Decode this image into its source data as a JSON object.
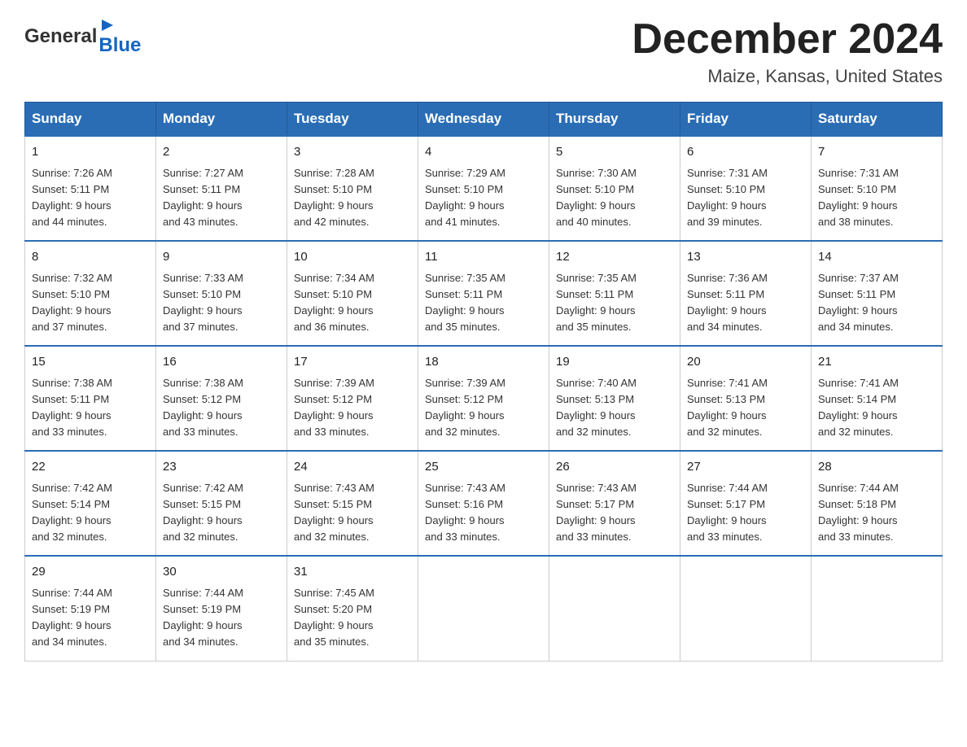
{
  "header": {
    "logo_general": "General",
    "logo_blue": "Blue",
    "month_title": "December 2024",
    "location": "Maize, Kansas, United States"
  },
  "days_of_week": [
    "Sunday",
    "Monday",
    "Tuesday",
    "Wednesday",
    "Thursday",
    "Friday",
    "Saturday"
  ],
  "weeks": [
    [
      {
        "day": "1",
        "sunrise": "7:26 AM",
        "sunset": "5:11 PM",
        "daylight": "9 hours and 44 minutes."
      },
      {
        "day": "2",
        "sunrise": "7:27 AM",
        "sunset": "5:11 PM",
        "daylight": "9 hours and 43 minutes."
      },
      {
        "day": "3",
        "sunrise": "7:28 AM",
        "sunset": "5:10 PM",
        "daylight": "9 hours and 42 minutes."
      },
      {
        "day": "4",
        "sunrise": "7:29 AM",
        "sunset": "5:10 PM",
        "daylight": "9 hours and 41 minutes."
      },
      {
        "day": "5",
        "sunrise": "7:30 AM",
        "sunset": "5:10 PM",
        "daylight": "9 hours and 40 minutes."
      },
      {
        "day": "6",
        "sunrise": "7:31 AM",
        "sunset": "5:10 PM",
        "daylight": "9 hours and 39 minutes."
      },
      {
        "day": "7",
        "sunrise": "7:31 AM",
        "sunset": "5:10 PM",
        "daylight": "9 hours and 38 minutes."
      }
    ],
    [
      {
        "day": "8",
        "sunrise": "7:32 AM",
        "sunset": "5:10 PM",
        "daylight": "9 hours and 37 minutes."
      },
      {
        "day": "9",
        "sunrise": "7:33 AM",
        "sunset": "5:10 PM",
        "daylight": "9 hours and 37 minutes."
      },
      {
        "day": "10",
        "sunrise": "7:34 AM",
        "sunset": "5:10 PM",
        "daylight": "9 hours and 36 minutes."
      },
      {
        "day": "11",
        "sunrise": "7:35 AM",
        "sunset": "5:11 PM",
        "daylight": "9 hours and 35 minutes."
      },
      {
        "day": "12",
        "sunrise": "7:35 AM",
        "sunset": "5:11 PM",
        "daylight": "9 hours and 35 minutes."
      },
      {
        "day": "13",
        "sunrise": "7:36 AM",
        "sunset": "5:11 PM",
        "daylight": "9 hours and 34 minutes."
      },
      {
        "day": "14",
        "sunrise": "7:37 AM",
        "sunset": "5:11 PM",
        "daylight": "9 hours and 34 minutes."
      }
    ],
    [
      {
        "day": "15",
        "sunrise": "7:38 AM",
        "sunset": "5:11 PM",
        "daylight": "9 hours and 33 minutes."
      },
      {
        "day": "16",
        "sunrise": "7:38 AM",
        "sunset": "5:12 PM",
        "daylight": "9 hours and 33 minutes."
      },
      {
        "day": "17",
        "sunrise": "7:39 AM",
        "sunset": "5:12 PM",
        "daylight": "9 hours and 33 minutes."
      },
      {
        "day": "18",
        "sunrise": "7:39 AM",
        "sunset": "5:12 PM",
        "daylight": "9 hours and 32 minutes."
      },
      {
        "day": "19",
        "sunrise": "7:40 AM",
        "sunset": "5:13 PM",
        "daylight": "9 hours and 32 minutes."
      },
      {
        "day": "20",
        "sunrise": "7:41 AM",
        "sunset": "5:13 PM",
        "daylight": "9 hours and 32 minutes."
      },
      {
        "day": "21",
        "sunrise": "7:41 AM",
        "sunset": "5:14 PM",
        "daylight": "9 hours and 32 minutes."
      }
    ],
    [
      {
        "day": "22",
        "sunrise": "7:42 AM",
        "sunset": "5:14 PM",
        "daylight": "9 hours and 32 minutes."
      },
      {
        "day": "23",
        "sunrise": "7:42 AM",
        "sunset": "5:15 PM",
        "daylight": "9 hours and 32 minutes."
      },
      {
        "day": "24",
        "sunrise": "7:43 AM",
        "sunset": "5:15 PM",
        "daylight": "9 hours and 32 minutes."
      },
      {
        "day": "25",
        "sunrise": "7:43 AM",
        "sunset": "5:16 PM",
        "daylight": "9 hours and 33 minutes."
      },
      {
        "day": "26",
        "sunrise": "7:43 AM",
        "sunset": "5:17 PM",
        "daylight": "9 hours and 33 minutes."
      },
      {
        "day": "27",
        "sunrise": "7:44 AM",
        "sunset": "5:17 PM",
        "daylight": "9 hours and 33 minutes."
      },
      {
        "day": "28",
        "sunrise": "7:44 AM",
        "sunset": "5:18 PM",
        "daylight": "9 hours and 33 minutes."
      }
    ],
    [
      {
        "day": "29",
        "sunrise": "7:44 AM",
        "sunset": "5:19 PM",
        "daylight": "9 hours and 34 minutes."
      },
      {
        "day": "30",
        "sunrise": "7:44 AM",
        "sunset": "5:19 PM",
        "daylight": "9 hours and 34 minutes."
      },
      {
        "day": "31",
        "sunrise": "7:45 AM",
        "sunset": "5:20 PM",
        "daylight": "9 hours and 35 minutes."
      },
      null,
      null,
      null,
      null
    ]
  ],
  "labels": {
    "sunrise_prefix": "Sunrise: ",
    "sunset_prefix": "Sunset: ",
    "daylight_prefix": "Daylight: "
  }
}
